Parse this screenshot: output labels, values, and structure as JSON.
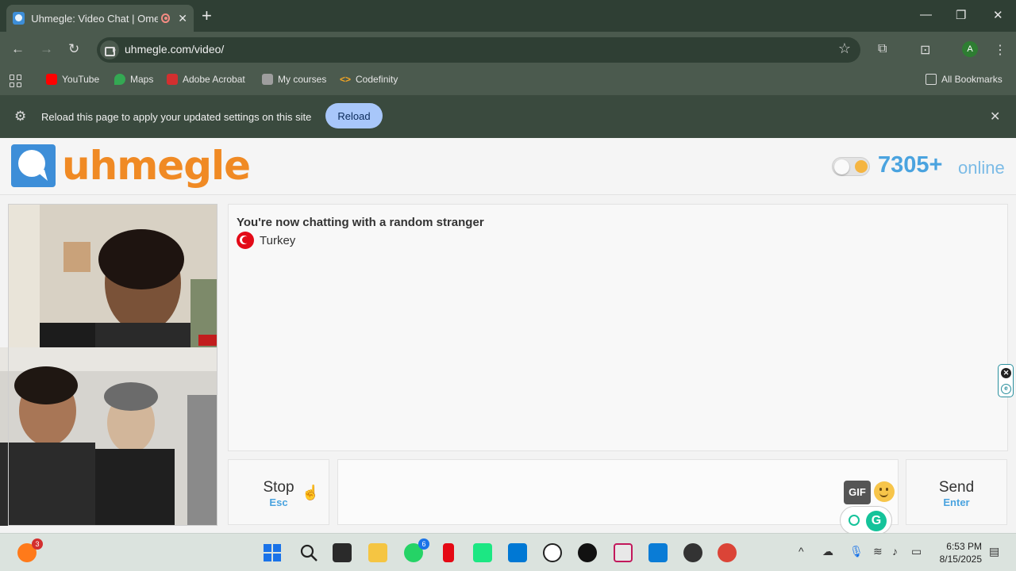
{
  "browser": {
    "tab_title": "Uhmegle: Video Chat | Omegle Alternative",
    "url": "uhmegle.com/video/",
    "profile_initial": "A",
    "bookmarks": [
      {
        "label": "YouTube",
        "icon": "youtube-icon",
        "color": "#ff0000"
      },
      {
        "label": "Maps",
        "icon": "maps-icon",
        "color": "#34a853"
      },
      {
        "label": "Adobe Acrobat",
        "icon": "acrobat-icon",
        "color": "#d32f2f"
      },
      {
        "label": "My courses",
        "icon": "courses-icon",
        "color": "#9e9e9e"
      },
      {
        "label": "Codefinity",
        "icon": "codefinity-icon",
        "color": "#f5a623"
      }
    ],
    "all_bookmarks": "All Bookmarks",
    "infobar": {
      "message": "Reload this page to apply your updated settings on this site",
      "button": "Reload"
    }
  },
  "site": {
    "logo_text": "uhmegle",
    "online_count": "7305+",
    "online_label": "online",
    "chat_status": "You're now chatting with a random stranger",
    "country": "Turkey",
    "stop": {
      "label": "Stop",
      "key": "Esc"
    },
    "send": {
      "label": "Send",
      "key": "Enter"
    },
    "gif_label": "GIF",
    "accent_color": "#4aa3df",
    "brand_color": "#f08a24"
  },
  "taskbar": {
    "firefox_badge": "3",
    "whatsapp_badge": "6",
    "time": "6:53 PM",
    "date": "8/15/2025"
  }
}
